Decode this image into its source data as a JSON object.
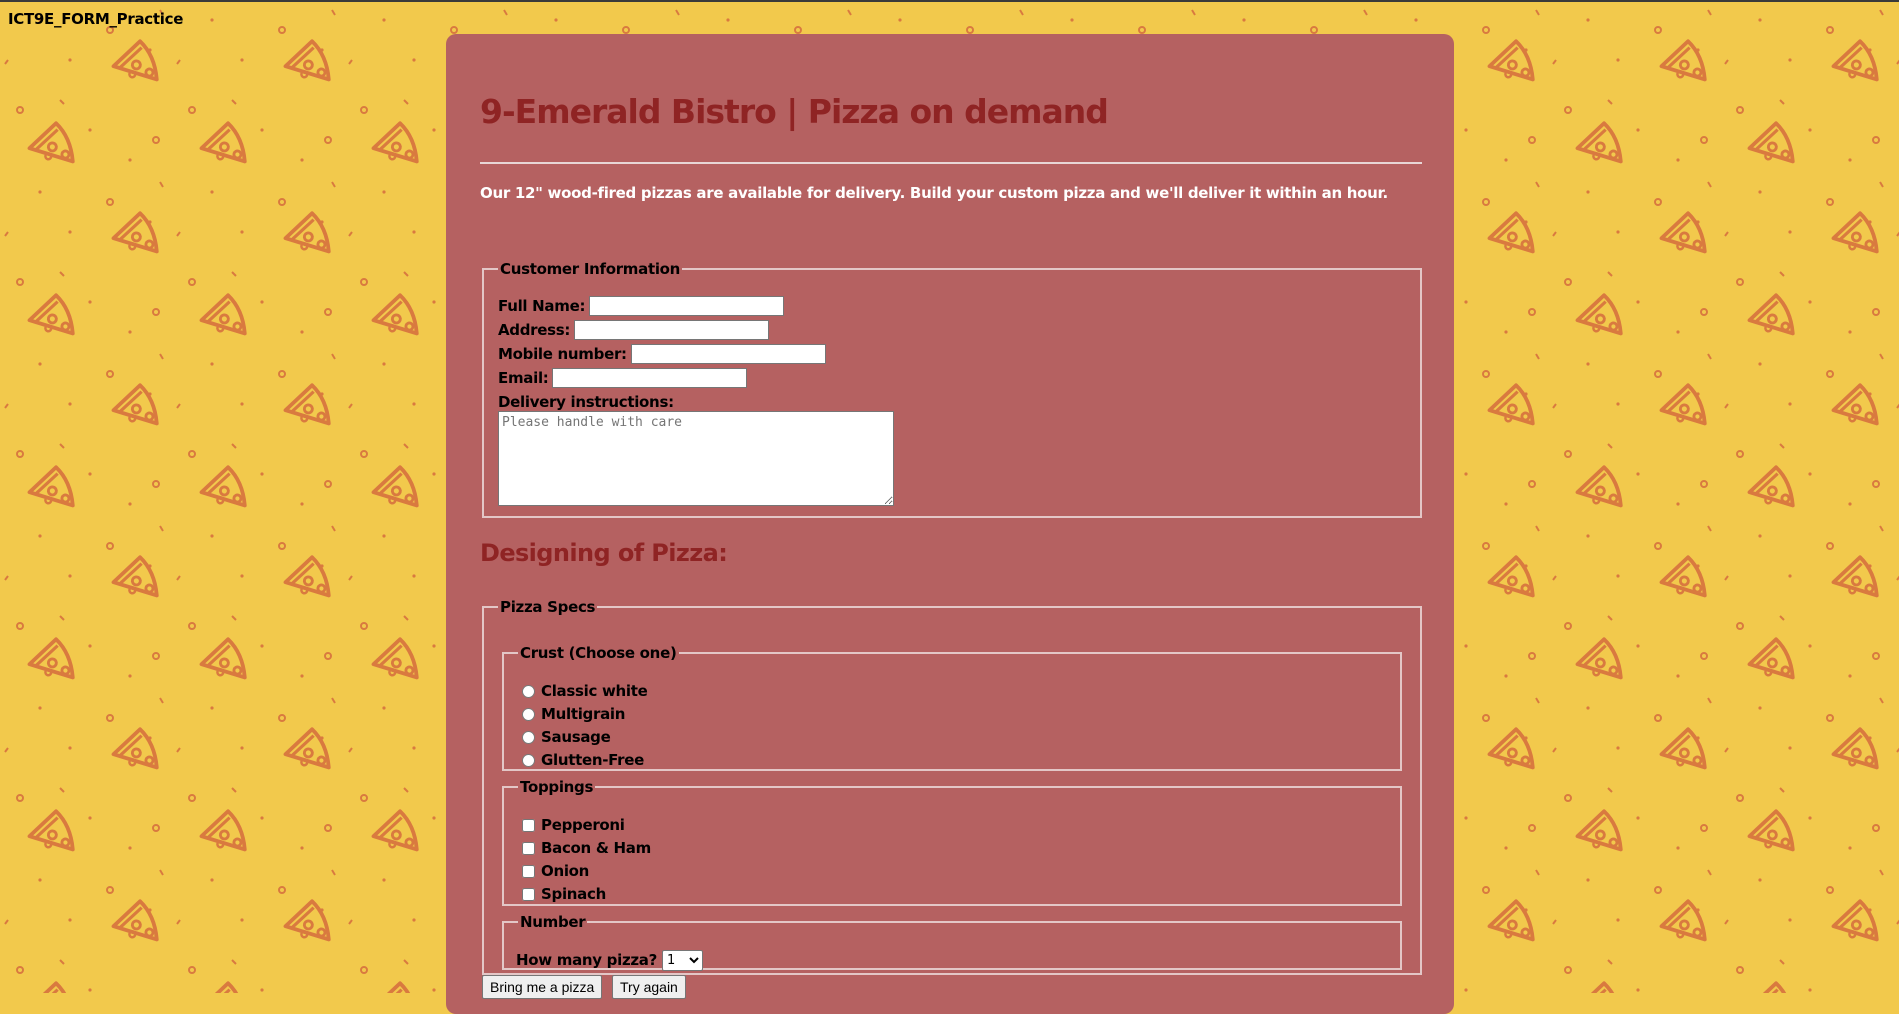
{
  "page": {
    "site_label": "ICT9E_FORM_Practice",
    "bg_color": "#f2c94c",
    "panel_color": "#b56161",
    "accent_color": "#8f2424"
  },
  "header": {
    "title": "9-Emerald Bistro | Pizza on demand",
    "intro": "Our 12\" wood-fired pizzas are available for delivery. Build your custom pizza and we'll deliver it within an hour."
  },
  "customer": {
    "legend": "Customer Information",
    "full_name_label": "Full Name:",
    "full_name_value": "",
    "address_label": "Address:",
    "address_value": "",
    "mobile_label": "Mobile number:",
    "mobile_value": "",
    "email_label": "Email:",
    "email_value": "",
    "instructions_label": "Delivery instructions:",
    "instructions_placeholder": "Please handle with care"
  },
  "design": {
    "heading": "Designing of Pizza:",
    "specs_legend": "Pizza Specs",
    "crust": {
      "legend": "Crust (Choose one)",
      "options": [
        "Classic white",
        "Multigrain",
        "Sausage",
        "Glutten-Free"
      ]
    },
    "toppings": {
      "legend": "Toppings",
      "options": [
        "Pepperoni",
        "Bacon & Ham",
        "Onion",
        "Spinach"
      ]
    },
    "number": {
      "legend": "Number",
      "label": "How many pizza?",
      "selected": "1"
    }
  },
  "actions": {
    "submit_label": "Bring me a pizza",
    "reset_label": "Try again"
  }
}
